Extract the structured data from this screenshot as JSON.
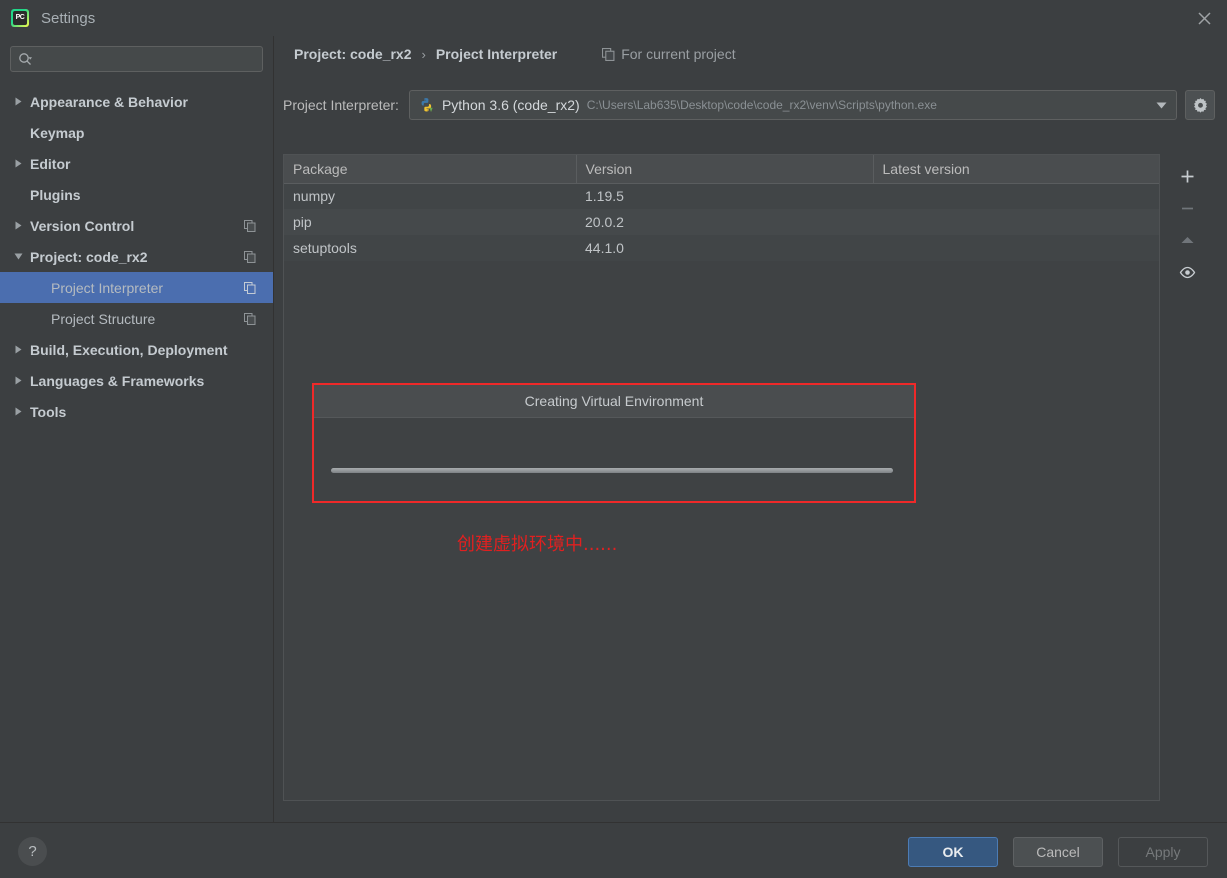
{
  "window": {
    "title": "Settings",
    "app_icon": "pycharm-icon",
    "close_icon": "close-icon"
  },
  "sidebar": {
    "search": {
      "placeholder": "",
      "value": "",
      "icon": "search-icon"
    },
    "items": [
      {
        "label": "Appearance & Behavior",
        "expandable": true,
        "expanded": false,
        "child": false,
        "bold": true,
        "copy": false
      },
      {
        "label": "Keymap",
        "expandable": false,
        "expanded": false,
        "child": false,
        "bold": true,
        "copy": false
      },
      {
        "label": "Editor",
        "expandable": true,
        "expanded": false,
        "child": false,
        "bold": true,
        "copy": false
      },
      {
        "label": "Plugins",
        "expandable": false,
        "expanded": false,
        "child": false,
        "bold": true,
        "copy": false
      },
      {
        "label": "Version Control",
        "expandable": true,
        "expanded": false,
        "child": false,
        "bold": true,
        "copy": true
      },
      {
        "label": "Project: code_rx2",
        "expandable": true,
        "expanded": true,
        "child": false,
        "bold": true,
        "copy": true
      },
      {
        "label": "Project Interpreter",
        "expandable": false,
        "expanded": false,
        "child": true,
        "bold": false,
        "copy": true,
        "selected": true
      },
      {
        "label": "Project Structure",
        "expandable": false,
        "expanded": false,
        "child": true,
        "bold": false,
        "copy": true
      },
      {
        "label": "Build, Execution, Deployment",
        "expandable": true,
        "expanded": false,
        "child": false,
        "bold": true,
        "copy": false
      },
      {
        "label": "Languages & Frameworks",
        "expandable": true,
        "expanded": false,
        "child": false,
        "bold": true,
        "copy": false
      },
      {
        "label": "Tools",
        "expandable": true,
        "expanded": false,
        "child": false,
        "bold": true,
        "copy": false
      }
    ]
  },
  "header": {
    "breadcrumb_root": "Project: code_rx2",
    "breadcrumb_sep": "›",
    "breadcrumb_leaf": "Project Interpreter",
    "for_project_label": "For current project",
    "for_project_icon": "copy-icon"
  },
  "interpreter": {
    "label": "Project Interpreter:",
    "icon": "python-venv-icon",
    "name": "Python 3.6 (code_rx2)",
    "path": "C:\\Users\\Lab635\\Desktop\\code\\code_rx2\\venv\\Scripts\\python.exe",
    "dropdown_icon": "chevron-down-icon",
    "settings_icon": "gear-icon"
  },
  "packages": {
    "columns": [
      "Package",
      "Version",
      "Latest version"
    ],
    "rows": [
      {
        "package": "numpy",
        "version": "1.19.5",
        "latest": ""
      },
      {
        "package": "pip",
        "version": "20.0.2",
        "latest": ""
      },
      {
        "package": "setuptools",
        "version": "44.1.0",
        "latest": ""
      }
    ],
    "tools": [
      {
        "name": "add-package-button",
        "icon": "plus-icon",
        "enabled": true
      },
      {
        "name": "remove-package-button",
        "icon": "minus-icon",
        "enabled": false
      },
      {
        "name": "upgrade-package-button",
        "icon": "arrow-up-icon",
        "enabled": false
      },
      {
        "name": "show-early-releases-button",
        "icon": "eye-icon",
        "enabled": true
      }
    ]
  },
  "progress_dialog": {
    "title": "Creating Virtual Environment",
    "progress_indeterminate": true,
    "highlight_color": "#ef2929"
  },
  "annotation": {
    "text": "创建虚拟环境中......",
    "color": "#e02020"
  },
  "footer": {
    "help_label": "?",
    "ok_label": "OK",
    "cancel_label": "Cancel",
    "apply_label": "Apply",
    "apply_enabled": false
  }
}
